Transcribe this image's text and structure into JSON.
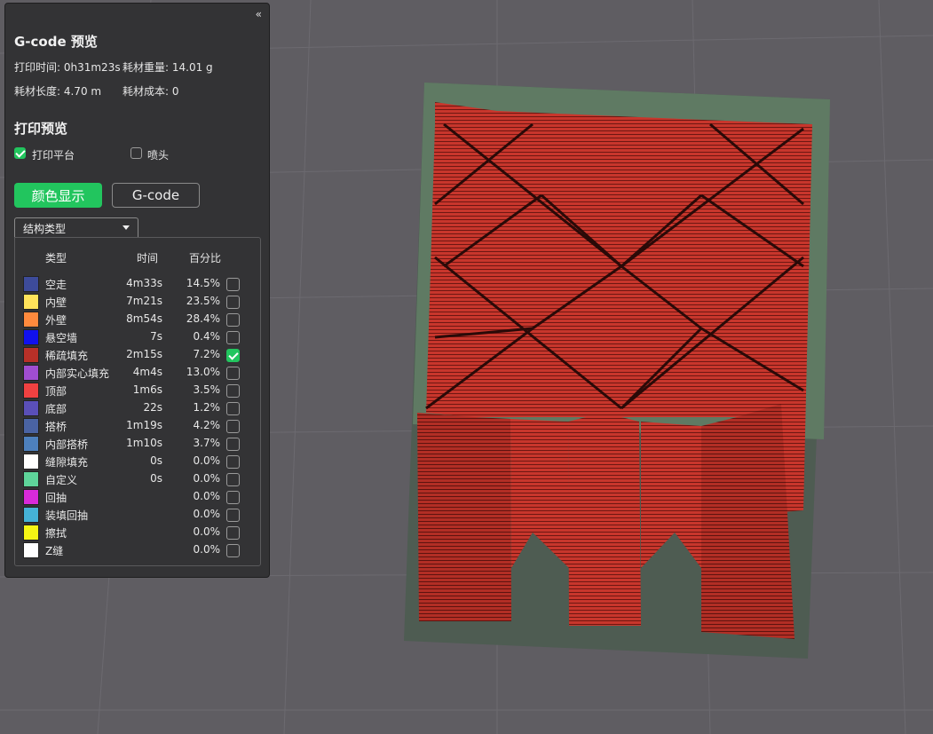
{
  "panel": {
    "collapse_icon": "«",
    "title": "G-code 预览",
    "print_time": "打印时间: 0h31m23s",
    "filament_weight": "耗材重量: 14.01 g",
    "filament_length": "耗材长度: 4.70 m",
    "filament_cost": "耗材成本: 0",
    "preview_title": "打印预览",
    "bed_label": "打印平台",
    "bed_checked": true,
    "nozzle_label": "喷头",
    "nozzle_checked": false,
    "color_button": "颜色显示",
    "gcode_button": "G-code",
    "dropdown_value": "结构类型"
  },
  "legend": {
    "headers": {
      "type": "类型",
      "time": "时间",
      "percent": "百分比"
    },
    "rows": [
      {
        "name": "空走",
        "time": "4m33s",
        "percent": "14.5%",
        "color": "#3d4b9a",
        "checked": false
      },
      {
        "name": "内壁",
        "time": "7m21s",
        "percent": "23.5%",
        "color": "#ffe35a",
        "checked": false
      },
      {
        "name": "外壁",
        "time": "8m54s",
        "percent": "28.4%",
        "color": "#ff8a3d",
        "checked": false
      },
      {
        "name": "悬空墙",
        "time": "7s",
        "percent": "0.4%",
        "color": "#1111ee",
        "checked": false
      },
      {
        "name": "稀疏填充",
        "time": "2m15s",
        "percent": "7.2%",
        "color": "#b83028",
        "checked": true
      },
      {
        "name": "内部实心填充",
        "time": "4m4s",
        "percent": "13.0%",
        "color": "#a04dd1",
        "checked": false
      },
      {
        "name": "顶部",
        "time": "1m6s",
        "percent": "3.5%",
        "color": "#f04141",
        "checked": false
      },
      {
        "name": "底部",
        "time": "22s",
        "percent": "1.2%",
        "color": "#5a4fb8",
        "checked": false
      },
      {
        "name": "搭桥",
        "time": "1m19s",
        "percent": "4.2%",
        "color": "#4a63a3",
        "checked": false
      },
      {
        "name": "内部搭桥",
        "time": "1m10s",
        "percent": "3.7%",
        "color": "#4d80bd",
        "checked": false
      },
      {
        "name": "缝隙填充",
        "time": "0s",
        "percent": "0.0%",
        "color": "#ffffff",
        "checked": false
      },
      {
        "name": "自定义",
        "time": "0s",
        "percent": "0.0%",
        "color": "#5ed49a",
        "checked": false
      },
      {
        "name": "回抽",
        "time": "",
        "percent": "0.0%",
        "color": "#d92ad9",
        "checked": false
      },
      {
        "name": "装填回抽",
        "time": "",
        "percent": "0.0%",
        "color": "#45b2d6",
        "checked": false
      },
      {
        "name": "擦拭",
        "time": "",
        "percent": "0.0%",
        "color": "#f5f514",
        "checked": false
      },
      {
        "name": "Z缝",
        "time": "",
        "percent": "0.0%",
        "color": "#ffffff",
        "checked": false
      }
    ]
  }
}
